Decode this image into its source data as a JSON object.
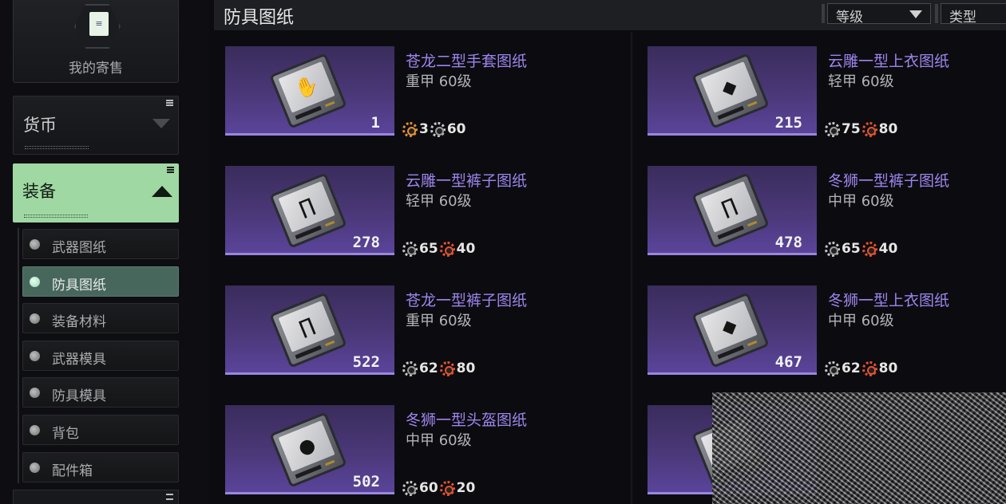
{
  "sidebar": {
    "my_sales": {
      "label": "我的寄售",
      "icon": "document-icon"
    },
    "categories": [
      {
        "label": "货币",
        "state": "collapsed"
      },
      {
        "label": "装备",
        "state": "expanded",
        "color": "#9fd8a3"
      }
    ],
    "subitems": [
      {
        "label": "武器图纸",
        "active": false
      },
      {
        "label": "防具图纸",
        "active": true
      },
      {
        "label": "装备材料",
        "active": false
      },
      {
        "label": "武器模具",
        "active": false
      },
      {
        "label": "防具模具",
        "active": false
      },
      {
        "label": "背包",
        "active": false
      },
      {
        "label": "配件箱",
        "active": false
      }
    ]
  },
  "header": {
    "title": "防具图纸",
    "filters": {
      "grade_label": "等级",
      "type_label": "类型"
    }
  },
  "items": [
    {
      "name": "苍龙二型手套图纸",
      "info": "重甲 60级",
      "qty": "1",
      "icon": "gloves-icon",
      "costs": [
        {
          "kind": "gold-gear",
          "value": "3"
        },
        {
          "kind": "silver-gear",
          "value": "60"
        }
      ]
    },
    {
      "name": "云雕一型上衣图纸",
      "info": "轻甲 60级",
      "qty": "215",
      "icon": "vest-icon",
      "costs": [
        {
          "kind": "silver-gear",
          "value": "75"
        },
        {
          "kind": "red-gear",
          "value": "80"
        }
      ]
    },
    {
      "name": "云雕一型裤子图纸",
      "info": "轻甲 60级",
      "qty": "278",
      "icon": "pants-icon",
      "costs": [
        {
          "kind": "silver-gear",
          "value": "65"
        },
        {
          "kind": "red-gear",
          "value": "40"
        }
      ]
    },
    {
      "name": "冬狮一型裤子图纸",
      "info": "中甲 60级",
      "qty": "478",
      "icon": "pants-icon",
      "costs": [
        {
          "kind": "silver-gear",
          "value": "65"
        },
        {
          "kind": "red-gear",
          "value": "40"
        }
      ]
    },
    {
      "name": "苍龙一型裤子图纸",
      "info": "重甲 60级",
      "qty": "522",
      "icon": "pants-icon",
      "costs": [
        {
          "kind": "silver-gear",
          "value": "62"
        },
        {
          "kind": "red-gear",
          "value": "80"
        }
      ]
    },
    {
      "name": "冬狮一型上衣图纸",
      "info": "中甲 60级",
      "qty": "467",
      "icon": "vest-icon",
      "costs": [
        {
          "kind": "silver-gear",
          "value": "62"
        },
        {
          "kind": "red-gear",
          "value": "80"
        }
      ]
    },
    {
      "name": "冬狮一型头盔图纸",
      "info": "中甲 60级",
      "qty": "502",
      "icon": "helmet-icon",
      "costs": [
        {
          "kind": "silver-gear",
          "value": "60"
        },
        {
          "kind": "red-gear",
          "value": "20"
        }
      ]
    }
  ],
  "glyphs": {
    "document": "≡",
    "gloves": "✋",
    "vest": "◆",
    "pants": "∏",
    "helmet": "●"
  }
}
